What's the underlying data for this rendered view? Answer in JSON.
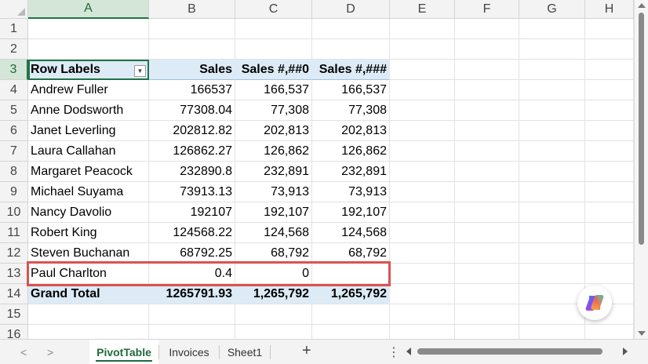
{
  "columns": [
    "A",
    "B",
    "C",
    "D",
    "E",
    "F",
    "G",
    "H"
  ],
  "rows": [
    "1",
    "2",
    "3",
    "4",
    "5",
    "6",
    "7",
    "8",
    "9",
    "10",
    "11",
    "12",
    "13",
    "14",
    "15",
    "16"
  ],
  "pivot": {
    "headers": [
      "Row Labels",
      "Sales",
      "Sales #,##0",
      "Sales #,###"
    ],
    "records": [
      [
        "Andrew Fuller",
        "166537",
        "166,537",
        "166,537"
      ],
      [
        "Anne Dodsworth",
        "77308.04",
        "77,308",
        "77,308"
      ],
      [
        "Janet Leverling",
        "202812.82",
        "202,813",
        "202,813"
      ],
      [
        "Laura Callahan",
        "126862.27",
        "126,862",
        "126,862"
      ],
      [
        "Margaret Peacock",
        "232890.8",
        "232,891",
        "232,891"
      ],
      [
        "Michael Suyama",
        "73913.13",
        "73,913",
        "73,913"
      ],
      [
        "Nancy Davolio",
        "192107",
        "192,107",
        "192,107"
      ],
      [
        "Robert King",
        "124568.22",
        "124,568",
        "124,568"
      ],
      [
        "Steven Buchanan",
        "68792.25",
        "68,792",
        "68,792"
      ],
      [
        "Paul Charlton",
        "0.4",
        "0",
        ""
      ]
    ],
    "total": [
      "Grand Total",
      "1265791.93",
      "1,265,792",
      "1,265,792"
    ]
  },
  "selected_cell": "A3",
  "highlight_row": "13",
  "highlight_color": "#d9534f",
  "header_fill_color": "#ddebf7",
  "tabs": [
    {
      "label": "PivotTable",
      "active": true
    },
    {
      "label": "Invoices",
      "active": false
    },
    {
      "label": "Sheet1",
      "active": false
    }
  ],
  "tabbar": {
    "add_label": "+",
    "menu_label": "⋮",
    "prev_label": "<",
    "next_label": ">"
  },
  "icons": {
    "copilot": "copilot-icon",
    "filter": "filter-dropdown-icon",
    "add_sheet": "plus-icon",
    "menu": "more-vertical-icon"
  }
}
